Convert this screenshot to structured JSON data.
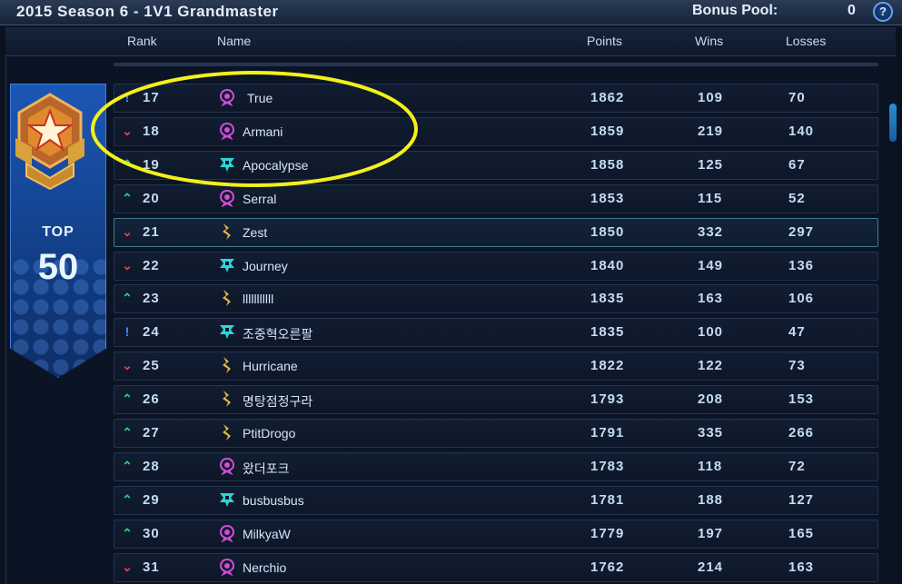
{
  "header": {
    "title": "2015 Season 6 - 1V1 Grandmaster",
    "bonus_pool_label": "Bonus Pool:",
    "bonus_pool_value": "0",
    "help_label": "?"
  },
  "columns": {
    "rank": "Rank",
    "name": "Name",
    "points": "Points",
    "wins": "Wins",
    "losses": "Losses"
  },
  "banner": {
    "top_label": "TOP",
    "top_value": "50"
  },
  "colors": {
    "zerg": "#d24cd8",
    "terran": "#2ed4d8",
    "protoss": "#e8b74a",
    "trend_up": "#2fd06b",
    "trend_down": "#ff3b3b",
    "trend_same": "#4f86ff",
    "annotation": "#f4f01a"
  },
  "players": [
    {
      "trend": "same",
      "trend_icon": "!",
      "rank": "17",
      "race": "zerg-icon",
      "name": "True",
      "points": "1862",
      "wins": "109",
      "losses": "70"
    },
    {
      "trend": "down",
      "trend_icon": "⌄",
      "rank": "18",
      "race": "zerg-icon",
      "name": "Armani",
      "points": "1859",
      "wins": "219",
      "losses": "140"
    },
    {
      "trend": "up",
      "trend_icon": "⌃",
      "rank": "19",
      "race": "terran-icon",
      "name": "Apocalypse",
      "points": "1858",
      "wins": "125",
      "losses": "67"
    },
    {
      "trend": "up",
      "trend_icon": "⌃",
      "rank": "20",
      "race": "zerg-icon",
      "name": "Serral",
      "points": "1853",
      "wins": "115",
      "losses": "52"
    },
    {
      "trend": "down",
      "trend_icon": "⌄",
      "rank": "21",
      "race": "protoss-icon",
      "name": "Zest",
      "points": "1850",
      "wins": "332",
      "losses": "297"
    },
    {
      "trend": "down",
      "trend_icon": "⌄",
      "rank": "22",
      "race": "terran-icon",
      "name": "Journey",
      "points": "1840",
      "wins": "149",
      "losses": "136"
    },
    {
      "trend": "up",
      "trend_icon": "⌃",
      "rank": "23",
      "race": "protoss-icon",
      "name": "lllllllllll",
      "points": "1835",
      "wins": "163",
      "losses": "106"
    },
    {
      "trend": "same",
      "trend_icon": "!",
      "rank": "24",
      "race": "terran-icon",
      "name": "조중혁오른팔",
      "points": "1835",
      "wins": "100",
      "losses": "47"
    },
    {
      "trend": "down",
      "trend_icon": "⌄",
      "rank": "25",
      "race": "protoss-icon",
      "name": "Hurricane",
      "points": "1822",
      "wins": "122",
      "losses": "73"
    },
    {
      "trend": "up",
      "trend_icon": "⌃",
      "rank": "26",
      "race": "protoss-icon",
      "name": "명탕점정구라",
      "points": "1793",
      "wins": "208",
      "losses": "153"
    },
    {
      "trend": "up",
      "trend_icon": "⌃",
      "rank": "27",
      "race": "protoss-icon",
      "name": "PtitDrogo",
      "points": "1791",
      "wins": "335",
      "losses": "266"
    },
    {
      "trend": "up",
      "trend_icon": "⌃",
      "rank": "28",
      "race": "zerg-icon",
      "name": "왔더포크",
      "points": "1783",
      "wins": "118",
      "losses": "72"
    },
    {
      "trend": "up",
      "trend_icon": "⌃",
      "rank": "29",
      "race": "terran-icon",
      "name": "busbusbus",
      "points": "1781",
      "wins": "188",
      "losses": "127"
    },
    {
      "trend": "up",
      "trend_icon": "⌃",
      "rank": "30",
      "race": "zerg-icon",
      "name": "MilkyaW",
      "points": "1779",
      "wins": "197",
      "losses": "165"
    },
    {
      "trend": "down",
      "trend_icon": "⌄",
      "rank": "31",
      "race": "zerg-icon",
      "name": "Nerchio",
      "points": "1762",
      "wins": "214",
      "losses": "163"
    }
  ]
}
